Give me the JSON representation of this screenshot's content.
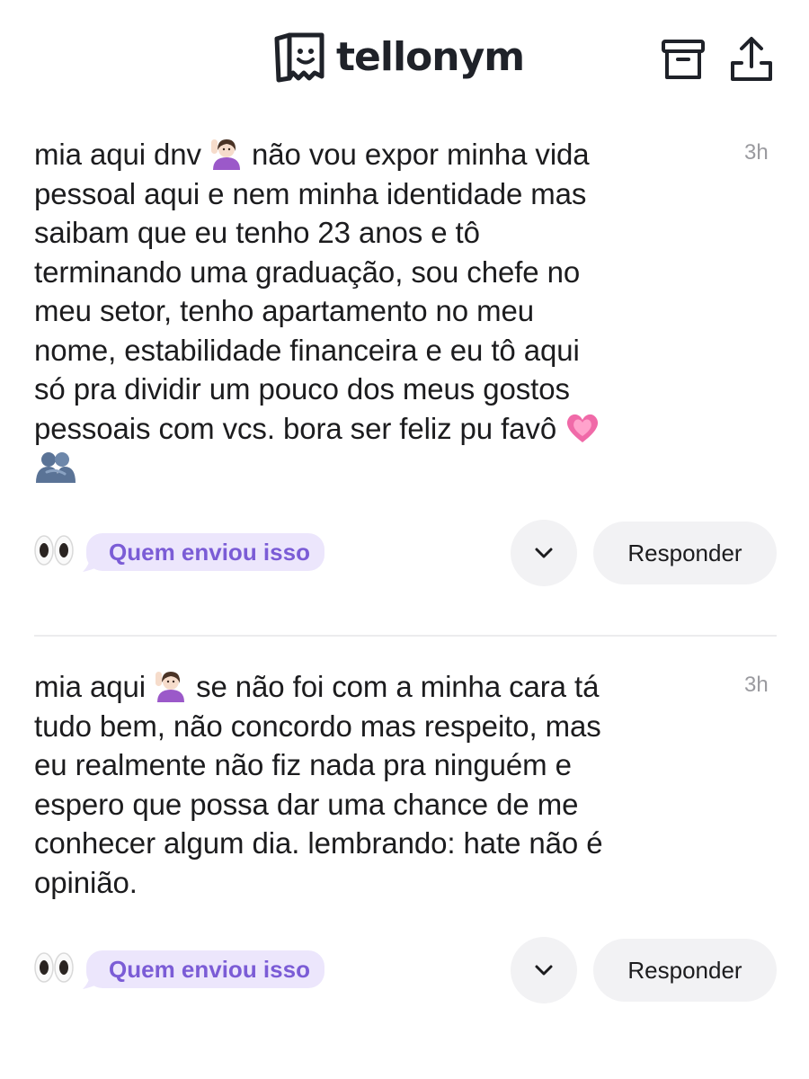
{
  "header": {
    "logo_text": "tellonym",
    "archive_icon": "archive-box-icon",
    "share_icon": "share-upload-icon"
  },
  "posts": [
    {
      "time": "3h",
      "lines": [
        "mia aqui dnv 🙋🏻‍♀️ não vou expor minha vida",
        "pessoal aqui e nem minha identidade mas",
        "saibam que eu tenho 23 anos e tô",
        "terminando uma graduação, sou chefe no",
        "meu setor, tenho apartamento no meu",
        "nome, estabilidade financeira e eu tô aqui",
        "só pra dividir um pouco dos meus gostos",
        "pessoais com vcs. bora ser feliz pu favô 💗",
        "🫂"
      ],
      "sender_label": "Quem enviou isso",
      "reply_label": "Responder"
    },
    {
      "time": "3h",
      "lines": [
        "mia aqui 🙋🏻‍♀️ se não foi com a minha cara tá",
        "tudo bem, não concordo mas respeito, mas",
        "eu realmente não fiz nada pra ninguém e",
        "espero que possa dar uma chance de me",
        "conhecer algum dia. lembrando: hate não é",
        "opinião."
      ],
      "sender_label": "Quem enviou isso",
      "reply_label": "Responder"
    }
  ],
  "colors": {
    "pill_bg": "#ece6fc",
    "pill_text": "#7b5cd6",
    "button_bg": "#f2f2f4",
    "time_text": "#9a9a9f"
  }
}
